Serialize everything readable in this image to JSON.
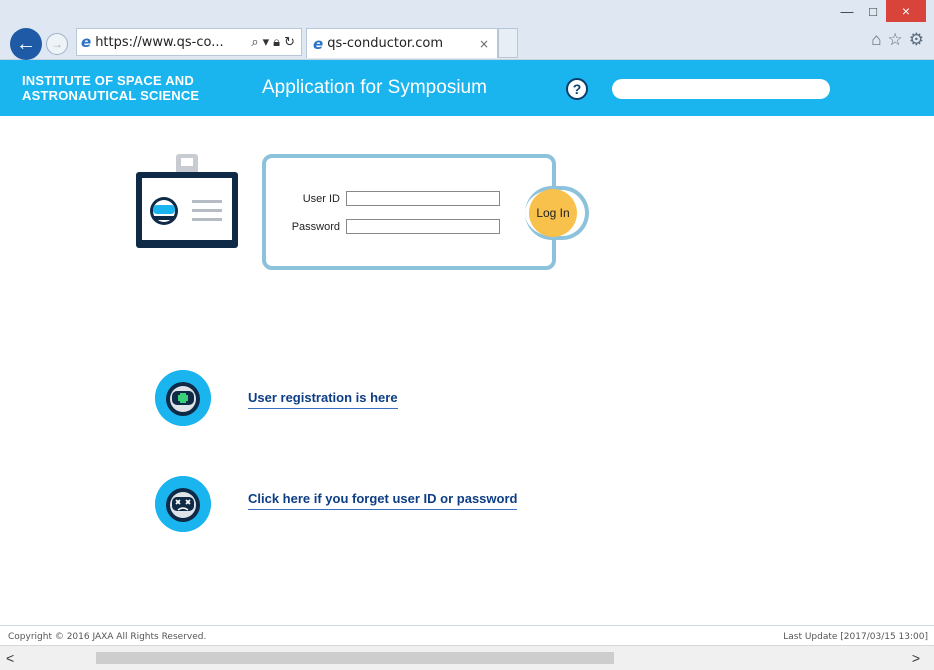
{
  "browser": {
    "address": "https://www.qs-co...",
    "tab_title": "qs-conductor.com",
    "tab_close": "×",
    "minimize": "—",
    "maximize": "□",
    "close": "×"
  },
  "header": {
    "org_line1": "INSTITUTE OF SPACE AND",
    "org_line2": "ASTRONAUTICAL SCIENCE",
    "title": "Application for Symposium",
    "help": "?",
    "bg_color": "#1ab4ee"
  },
  "login": {
    "user_id_label": "User ID",
    "password_label": "Password",
    "button": "Log In",
    "button_color": "#f8c14c"
  },
  "links": {
    "register": "User registration is here",
    "forgot": "Click here if you forget user ID or password"
  },
  "footer": {
    "copyright": "Copyright © 2016 JAXA All Rights Reserved.",
    "last_update": "Last Update [2017/03/15 13:00]"
  },
  "scrollbar": {
    "left": "<",
    "right": ">"
  }
}
